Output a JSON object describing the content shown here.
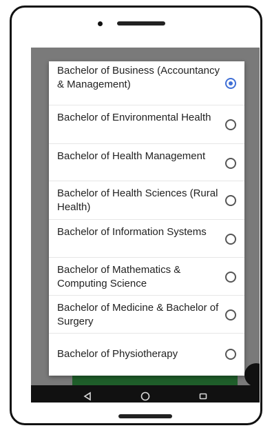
{
  "dialog": {
    "options": [
      {
        "label": "Bachelor of Business (Accountancy & Management)",
        "selected": true
      },
      {
        "label": "Bachelor of Environmental Health",
        "selected": false
      },
      {
        "label": "Bachelor of Health Management",
        "selected": false
      },
      {
        "label": "Bachelor of Health Sciences (Rural Health)",
        "selected": false
      },
      {
        "label": "Bachelor of Information Systems",
        "selected": false
      },
      {
        "label": "Bachelor of Mathematics & Computing Science",
        "selected": false
      },
      {
        "label": "Bachelor of Medicine & Bachelor of Surgery",
        "selected": false
      },
      {
        "label": "Bachelor of Physiotherapy",
        "selected": false
      }
    ]
  },
  "icons": {
    "back": "back-triangle-icon",
    "home": "home-circle-icon",
    "recents": "recents-square-icon"
  },
  "colors": {
    "accent": "#3f6fd6",
    "scrim": "#7a7a7a",
    "navbar": "#111111"
  }
}
